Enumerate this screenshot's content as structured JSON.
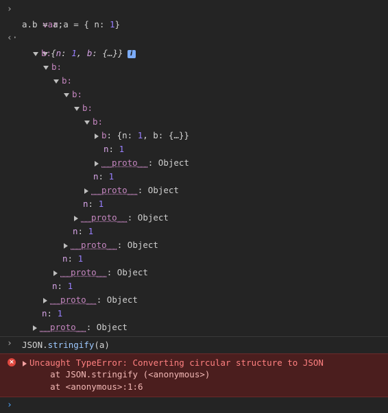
{
  "prompts": {
    "input": "›",
    "output": "‹·"
  },
  "colors": {
    "background": "#242424",
    "error_bg": "#4b1e1e",
    "error_text": "#ff8080",
    "number": "#9980ff",
    "property": "#c586c0",
    "info_badge": "#7cacf8"
  },
  "entry1": {
    "line1": {
      "kw": "var",
      "rest1": " a = { n: ",
      "num": "1",
      "rest2": "}"
    },
    "line2": "a.b = a;"
  },
  "result": {
    "preview": {
      "open": "{",
      "n_key": "n",
      "colon1": ": ",
      "n_val": "1",
      "sep": ", ",
      "b_key": "b",
      "colon2": ": ",
      "b_val": "{…}",
      "close": "}"
    },
    "info_icon": "i",
    "tree": {
      "b_labels": [
        "b:",
        "b:",
        "b:",
        "b:",
        "b:",
        "b:"
      ],
      "innermost": {
        "key": "b",
        "sep": ": ",
        "preview_open": "{n: ",
        "n_val": "1",
        "mid": ", b: {…}}"
      },
      "n_key": "n",
      "n_colon": ": ",
      "n_value": "1",
      "proto_name": "__proto__",
      "proto_colon": ": ",
      "proto_value": "Object"
    }
  },
  "entry2": {
    "obj": "JSON.",
    "fn": "stringify",
    "args": "(a)"
  },
  "error": {
    "icon": "×",
    "message": "Uncaught TypeError: Converting circular structure to JSON",
    "stack": [
      "    at JSON.stringify (<anonymous>)",
      "    at <anonymous>:1:6"
    ]
  }
}
